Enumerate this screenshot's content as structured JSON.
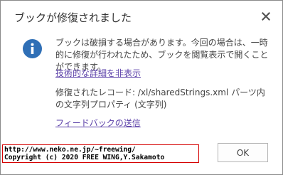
{
  "dialog": {
    "title": "ブックが修復されました",
    "message": "ブックは破損する場合があります。今回の場合は、一時的に修復が行われたため、ブックを閲覧表示で開くことができます。",
    "details_link": "技術的な詳細を非表示",
    "detail_text": "修復されたレコード: /xl/sharedStrings.xml パーツ内の文字列プロパティ (文字列)",
    "feedback_link": "フィードバックの送信",
    "ok_label": "OK",
    "close_icon": "close-icon",
    "info_icon": "info-icon",
    "accent_color": "#2f6fb6",
    "link_color": "#5a3fa8"
  },
  "watermark": {
    "line1": "http://www.neko.ne.jp/~freewing/",
    "line2": "Copyright (c) 2020 FREE WING,Y.Sakamoto",
    "border_color": "#d40000"
  }
}
